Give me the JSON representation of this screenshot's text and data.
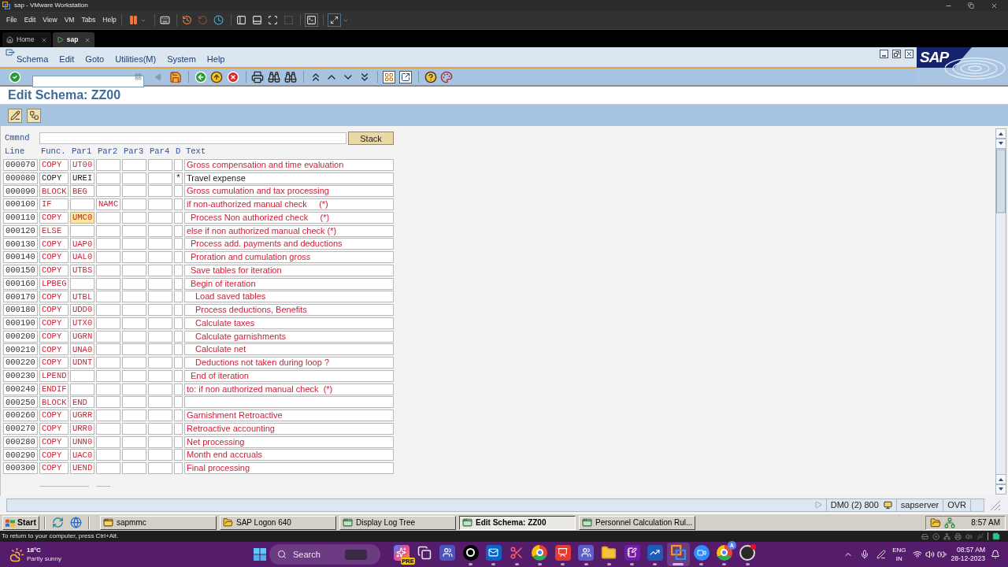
{
  "vmware": {
    "title": "sap - VMware Workstation",
    "menu": [
      "File",
      "Edit",
      "View",
      "VM",
      "Tabs",
      "Help"
    ],
    "tabs": [
      {
        "kind": "home",
        "label": "Home",
        "selected": false
      },
      {
        "kind": "vm",
        "label": "sap",
        "selected": true
      }
    ],
    "status_hint": "To return to your computer, press Ctrl+Alt."
  },
  "sap": {
    "menu": [
      "Schema",
      "Edit",
      "Goto",
      "Utilities(M)",
      "System",
      "Help"
    ],
    "logo": "SAP",
    "title": "Edit Schema: ZZ00",
    "command": {
      "label": "Cmmnd",
      "button": "Stack"
    },
    "columns": [
      "Line",
      "Func.",
      "Par1",
      "Par2",
      "Par3",
      "Par4",
      "D",
      "Text"
    ],
    "rows": [
      {
        "line": "000070",
        "func": "COPY",
        "par1": "UT00",
        "text": "Gross compensation and time evaluation",
        "color": "#cc2238",
        "par1_focused": false
      },
      {
        "line": "000080",
        "func": "COPY",
        "par1": "UREI",
        "d": "*",
        "text": "Travel expense",
        "color": "#1c1c1c",
        "par1_focused": false
      },
      {
        "line": "000090",
        "func": "BLOCK",
        "par1": "BEG",
        "text": "Gross cumulation and tax processing",
        "color": "#cc2238",
        "par1_focused": false
      },
      {
        "line": "000100",
        "func": "IF",
        "par2": "NAMC",
        "text": "if non-authorized manual check     (*)",
        "color": "#cc2238",
        "par1_focused": false,
        "children": [
          {
            "line": "000110",
            "func": "COPY",
            "par1": "UMC0",
            "text": "Process Non authorized check     (*)",
            "color": "#cc2238",
            "par1_focused": true
          }
        ]
      },
      {
        "line": "000120",
        "func": "ELSE",
        "text": "else if non authorized manual check (*)",
        "color": "#cc2238",
        "par1_focused": false,
        "children": [
          {
            "line": "000130",
            "func": "COPY",
            "par1": "UAP0",
            "text": "Process add. payments and deductions",
            "color": "#cc2238",
            "par1_focused": false
          },
          {
            "line": "000140",
            "func": "COPY",
            "par1": "UAL0",
            "text": "Proration and cumulation gross",
            "color": "#cc2238",
            "par1_focused": false
          },
          {
            "line": "000150",
            "func": "COPY",
            "par1": "UTBS",
            "text": "Save tables for iteration",
            "color": "#cc2238",
            "par1_focused": false
          },
          {
            "line": "000160",
            "func": "LPBEG",
            "text": "Begin of iteration",
            "color": "#cc2238",
            "par1_focused": false,
            "children": [
              {
                "line": "000170",
                "func": "COPY",
                "par1": "UTBL",
                "text": "Load saved tables",
                "color": "#cc2238",
                "par1_focused": false
              },
              {
                "line": "000180",
                "func": "COPY",
                "par1": "UDD0",
                "text": "Process deductions, Benefits",
                "color": "#cc2238",
                "par1_focused": false
              },
              {
                "line": "000190",
                "func": "COPY",
                "par1": "UTX0",
                "text": "Calculate taxes",
                "color": "#cc2238",
                "par1_focused": false
              },
              {
                "line": "000200",
                "func": "COPY",
                "par1": "UGRN",
                "text": "Calculate garnishments",
                "color": "#cc2238",
                "par1_focused": false
              },
              {
                "line": "000210",
                "func": "COPY",
                "par1": "UNA0",
                "text": "Calculate net",
                "color": "#cc2238",
                "par1_focused": false
              },
              {
                "line": "000220",
                "func": "COPY",
                "par1": "UDNT",
                "text": "Deductions not taken during loop ?",
                "color": "#cc2238",
                "par1_focused": false
              }
            ]
          },
          {
            "line": "000230",
            "func": "LPEND",
            "text": "End of iteration",
            "color": "#cc2238",
            "par1_focused": false
          }
        ]
      },
      {
        "line": "000240",
        "func": "ENDIF",
        "text": "to: if non authorized manual check  (*)",
        "color": "#cc2238",
        "par1_focused": false
      },
      {
        "line": "000250",
        "func": "BLOCK",
        "par1": "END",
        "color": "#cc2238",
        "par1_focused": false
      },
      {
        "line": "000260",
        "func": "COPY",
        "par1": "UGRR",
        "text": "Garnishment Retroactive",
        "color": "#cc2238",
        "par1_focused": false
      },
      {
        "line": "000270",
        "func": "COPY",
        "par1": "URR0",
        "text": "Retroactive accounting",
        "color": "#cc2238",
        "par1_focused": false
      },
      {
        "line": "000280",
        "func": "COPY",
        "par1": "UNN0",
        "text": "Net processing",
        "color": "#cc2238",
        "par1_focused": false
      },
      {
        "line": "000290",
        "func": "COPY",
        "par1": "UAC0",
        "text": "Month end accruals",
        "color": "#cc2238",
        "par1_focused": false
      },
      {
        "line": "000300",
        "func": "COPY",
        "par1": "UEND",
        "text": "Final processing",
        "color": "#cc2238",
        "par1_focused": false
      }
    ],
    "status_bar": {
      "system": "DM0 (2) 800",
      "server": "sapserver",
      "mode": "OVR"
    }
  },
  "guest_taskbar": {
    "start": "Start",
    "tasks": [
      {
        "kind": "console",
        "label": "sapmmc",
        "selected": false
      },
      {
        "kind": "logon",
        "label": "SAP Logon 640",
        "selected": false
      },
      {
        "kind": "window",
        "label": "Display Log Tree",
        "selected": false
      },
      {
        "kind": "window",
        "label": "Edit Schema: ZZ00",
        "selected": true
      },
      {
        "kind": "window",
        "label": "Personnel Calculation Rul...",
        "selected": false
      }
    ],
    "clock": "8:57 AM"
  },
  "host_taskbar": {
    "weather": {
      "temperature": "18°C",
      "condition": "Partly sunny"
    },
    "search": {
      "placeholder": "Search"
    },
    "apps": [
      {
        "kind": "assistant",
        "badge": "PRE",
        "running": false,
        "active": false
      },
      {
        "kind": "desktops",
        "running": false,
        "active": false
      },
      {
        "kind": "team-chat",
        "running": false,
        "active": false
      },
      {
        "kind": "ring",
        "running": true,
        "active": false
      },
      {
        "kind": "mail",
        "running": true,
        "active": false
      },
      {
        "kind": "snip",
        "running": true,
        "active": false
      },
      {
        "kind": "browser",
        "running": true,
        "active": false
      },
      {
        "kind": "slides",
        "running": true,
        "active": false
      },
      {
        "kind": "team",
        "running": true,
        "active": false
      },
      {
        "kind": "folder",
        "running": true,
        "active": false
      },
      {
        "kind": "notes",
        "running": true,
        "active": false
      },
      {
        "kind": "chart",
        "running": true,
        "active": false
      },
      {
        "kind": "vm",
        "running": true,
        "active": true
      },
      {
        "kind": "video",
        "running": true,
        "active": false
      },
      {
        "kind": "browser",
        "badge": "A",
        "running": true,
        "active": false
      },
      {
        "kind": "recorder",
        "running": true,
        "active": false
      }
    ],
    "language": {
      "input": "ENG",
      "region": "IN"
    },
    "time": "08:57 AM",
    "date": "28-12-2023"
  }
}
